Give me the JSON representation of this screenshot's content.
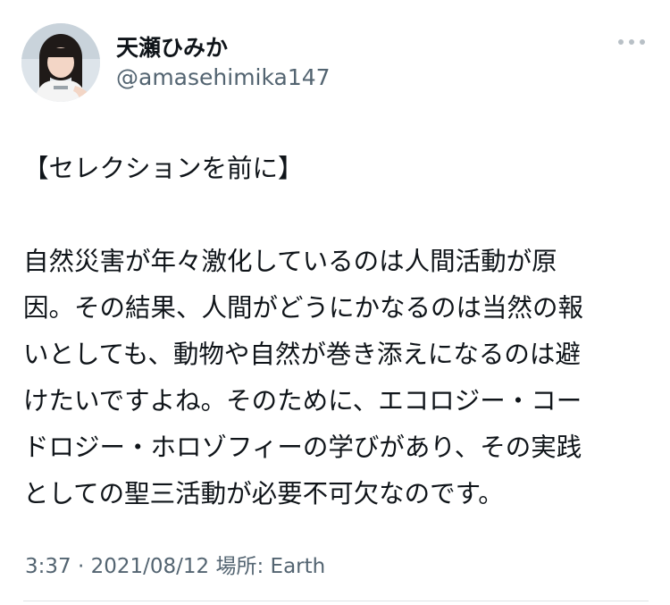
{
  "author": {
    "display_name": "天瀬ひみか",
    "handle": "@amasehimika147"
  },
  "tweet": {
    "heading": "【セレクションを前に】",
    "body_lines": [
      "自然災害が年々激化しているのは人間活動が原",
      "因。その結果、人間がどうにかなるのは当然の報",
      "いとしても、動物や自然が巻き添えになるのは避",
      "けたいですよね。そのために、エコロジー・コー",
      "ドロジー・ホロゾフィーの学びがあり、その実践",
      "としての聖三活動が必要不可欠なのです。"
    ]
  },
  "meta": {
    "time": "3:37",
    "separator": "·",
    "date": "2021/08/12",
    "location_label": "場所: Earth"
  },
  "icons": {
    "more": "more-horizontal-icon",
    "avatar": "avatar-photo"
  },
  "colors": {
    "text": "#0f1419",
    "secondary": "#536471",
    "divider": "#dfe3e6"
  }
}
